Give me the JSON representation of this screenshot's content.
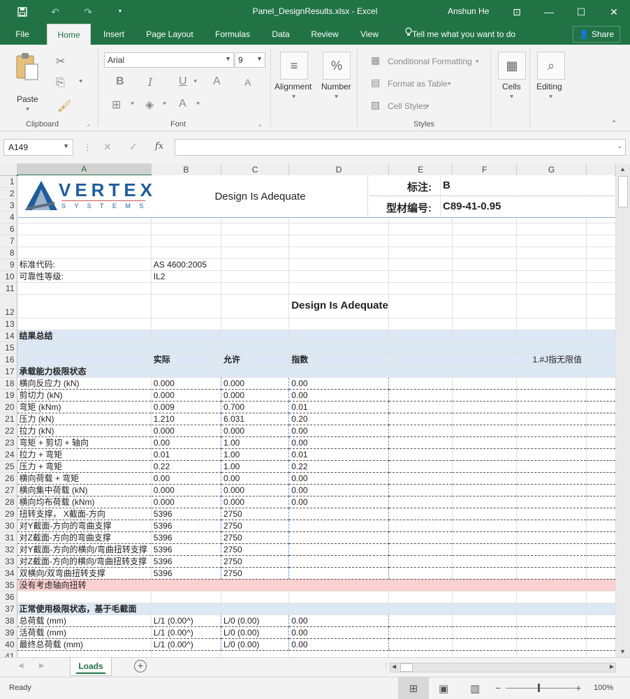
{
  "window": {
    "title": "Panel_DesignResults.xlsx  -  Excel",
    "user": "Anshun He",
    "qa_save_icon": "save-icon",
    "qa_undo": "↶",
    "qa_redo": "↷",
    "qa_more": "⯆",
    "min": "—",
    "max": "☐",
    "close": "✕",
    "restore_icon": "⊡"
  },
  "tabs": [
    "File",
    "Home",
    "Insert",
    "Page Layout",
    "Formulas",
    "Data",
    "Review",
    "View"
  ],
  "tell_me": "Tell me what you want to do",
  "share": "Share",
  "ribbon": {
    "clipboard": {
      "paste": "Paste",
      "label": "Clipboard"
    },
    "font": {
      "name": "Arial",
      "size": "9",
      "label": "Font",
      "bold": "B",
      "italic": "I",
      "underline": "U",
      "grow": "A",
      "shrink": "A",
      "color": "A"
    },
    "alignment": "Alignment",
    "number": "Number",
    "styles": {
      "cf": "Conditional Formatting",
      "fat": "Format as Table",
      "cs": "Cell Styles",
      "label": "Styles"
    },
    "cells": "Cells",
    "editing": "Editing"
  },
  "formula_bar": {
    "name_box": "A149",
    "fx": "fx",
    "value": ""
  },
  "columns": [
    "A",
    "B",
    "C",
    "D",
    "E",
    "F",
    "G"
  ],
  "sheet": {
    "logo_main": "VERTEX",
    "logo_sub": "S Y S T E M S",
    "header_status": "Design Is Adequate",
    "label_mark": "标注:",
    "mark_value": "B",
    "label_section": "型材编号:",
    "section_value": "C89-41-0.95",
    "std_label": "标准代码:",
    "std_value": "AS 4600:2005",
    "rel_label": "可靠性等级:",
    "rel_value": "IL2",
    "status_big": "Design Is Adequate",
    "summary_title": "结果总结",
    "col_actual": "实际",
    "col_allow": "允许",
    "col_index": "指数",
    "note_f16": "1.#J指无限值",
    "uls_title": "承载能力极限状态",
    "uls_rows": [
      [
        "横向反应力 (kN)",
        "0.000",
        "0.000",
        "0.00"
      ],
      [
        "剪切力 (kN)",
        "0.000",
        "0.000",
        "0.00"
      ],
      [
        "弯矩 (kNm)",
        "0.009",
        "0.700",
        "0.01"
      ],
      [
        "压力 (kN)",
        "1.210",
        "6.031",
        "0.20"
      ],
      [
        "拉力 (kN)",
        "0.000",
        "0.000",
        "0.00"
      ],
      [
        "弯矩 + 剪切 + 轴向",
        "0.00",
        "1.00",
        "0.00"
      ],
      [
        "拉力 + 弯矩",
        "0.01",
        "1.00",
        "0.01"
      ],
      [
        "压力 + 弯矩",
        "0.22",
        "1.00",
        "0.22"
      ],
      [
        "横向荷载 + 弯矩",
        "0.00",
        "0.00",
        "0.00"
      ],
      [
        "横向集中荷载 (kN)",
        "0.000",
        "0.000",
        "0.00"
      ],
      [
        "横向均布荷载 (kNm)",
        "0.000",
        "0.000",
        "0.00"
      ],
      [
        "扭转支撑，  X截面-方向",
        "5396",
        "2750",
        ""
      ],
      [
        "对Y截面-方向的弯曲支撑",
        "5396",
        "2750",
        ""
      ],
      [
        "对Z截面-方向的弯曲支撑",
        "5396",
        "2750",
        ""
      ],
      [
        "对Y截面-方向的横向/弯曲扭转支撑",
        "5396",
        "2750",
        ""
      ],
      [
        "对Z截面-方向的横向/弯曲扭转支撑",
        "5396",
        "2750",
        ""
      ],
      [
        "双横向/双弯曲扭转支撑",
        "5396",
        "2750",
        ""
      ]
    ],
    "warning": "没有考虑轴向扭转",
    "sls_title": "正常使用极限状态，基于毛截面",
    "sls_rows": [
      [
        "总荷载 (mm)",
        "L/1 (0.00^)",
        "L/0 (0.00)",
        "0.00"
      ],
      [
        "活荷载 (mm)",
        "L/1 (0.00^)",
        "L/0 (0.00)",
        "0.00"
      ],
      [
        "最终总荷载 (mm)",
        "L/1 (0.00^)",
        "L/0 (0.00)",
        "0.00"
      ]
    ]
  },
  "sheet_tab": "Loads",
  "status": {
    "ready": "Ready",
    "zoom": "100%"
  }
}
